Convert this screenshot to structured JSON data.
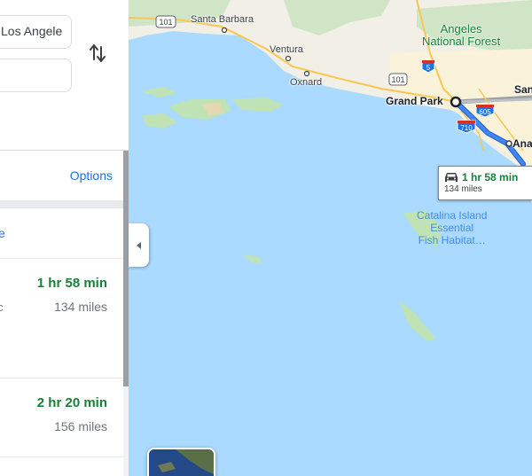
{
  "directions": {
    "origin_value": "Los Angele",
    "destination_value": "",
    "options_label": "Options",
    "link_text": "e",
    "routes": [
      {
        "time": "1 hr 58 min",
        "distance": "134 miles",
        "via": "c"
      },
      {
        "time": "2 hr 20 min",
        "distance": "156 miles"
      }
    ]
  },
  "map": {
    "labels": {
      "santa_barbara": "Santa Barbara",
      "ventura": "Ventura",
      "oxnard": "Oxnard",
      "grand_park": "Grand Park",
      "santa_ana_partial": "San",
      "anaheim_partial": "Ana",
      "angeles_nf": "Angeles\nNational Forest",
      "catalina": "Catalina Island\nEssential\nFish Habitat…"
    },
    "shields": {
      "us101_a": "101",
      "us101_b": "101",
      "i5": "5",
      "i605": "605",
      "i710": "710"
    },
    "route_callout": {
      "time": "1 hr 58 min",
      "distance": "134 miles",
      "icon": "car-icon"
    },
    "colors": {
      "route": "#1a73e8",
      "water": "#aadaff",
      "land": "#f5f3ed",
      "park": "#c8e6c9",
      "time_green": "#188038"
    }
  }
}
